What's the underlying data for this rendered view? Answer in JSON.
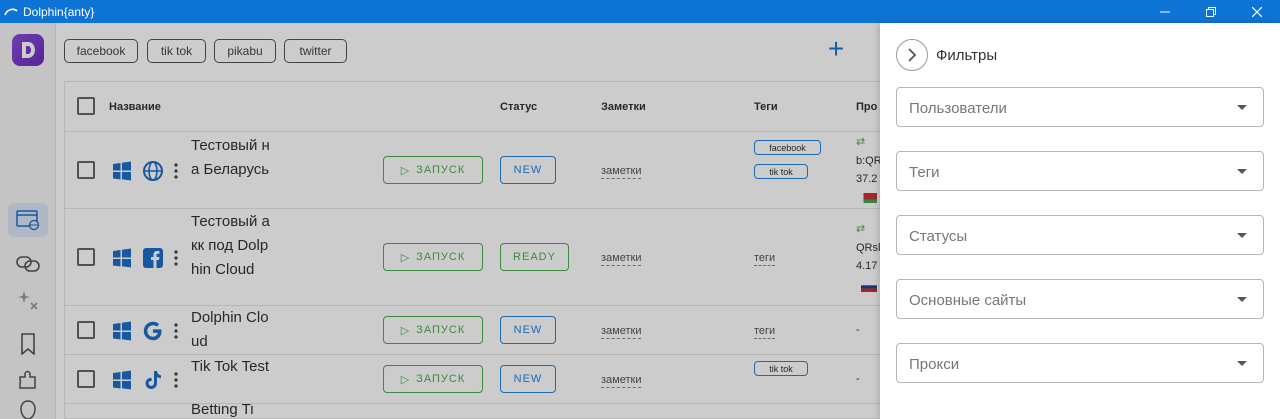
{
  "window": {
    "title": "Dolphin{anty}"
  },
  "top_tags": [
    "facebook",
    "tik tok",
    "pikabu",
    "twitter"
  ],
  "columns": {
    "name": "Название",
    "status": "Статус",
    "notes": "Заметки",
    "tags": "Теги",
    "proxy": "Про"
  },
  "launch_label": "ЗАПУСК",
  "profiles": [
    {
      "name": "Тестовый на Беларусь",
      "status": "NEW",
      "notes": "заметки",
      "tags": [
        "facebook",
        "tik tok"
      ],
      "proxy": [
        "⇄",
        "b:QR",
        "37.2"
      ],
      "site": "globe"
    },
    {
      "name": "Тестовый акк под Dolphin Cloud",
      "status": "READY",
      "notes": "заметки",
      "tags_text": "теги",
      "proxy": [
        "⇄",
        "QRsl",
        "4.17"
      ],
      "site": "facebook"
    },
    {
      "name": "Dolphin Cloud",
      "status": "NEW",
      "notes": "заметки",
      "tags_text": "теги",
      "proxy": [
        "-"
      ],
      "site": "google"
    },
    {
      "name": "Tik Tok Test",
      "status": "NEW",
      "notes": "заметки",
      "tags": [
        "tik tok"
      ],
      "proxy": [
        "-"
      ],
      "site": "tiktok"
    },
    {
      "name": "Betting Ti",
      "site": "none"
    }
  ],
  "filters": {
    "title": "Фильтры",
    "fields": [
      "Пользователи",
      "Теги",
      "Статусы",
      "Основные сайты",
      "Прокси"
    ]
  },
  "colors": {
    "accent": "#0d74d6",
    "launch": "#4caf50",
    "status_new": "#1e88e5"
  }
}
